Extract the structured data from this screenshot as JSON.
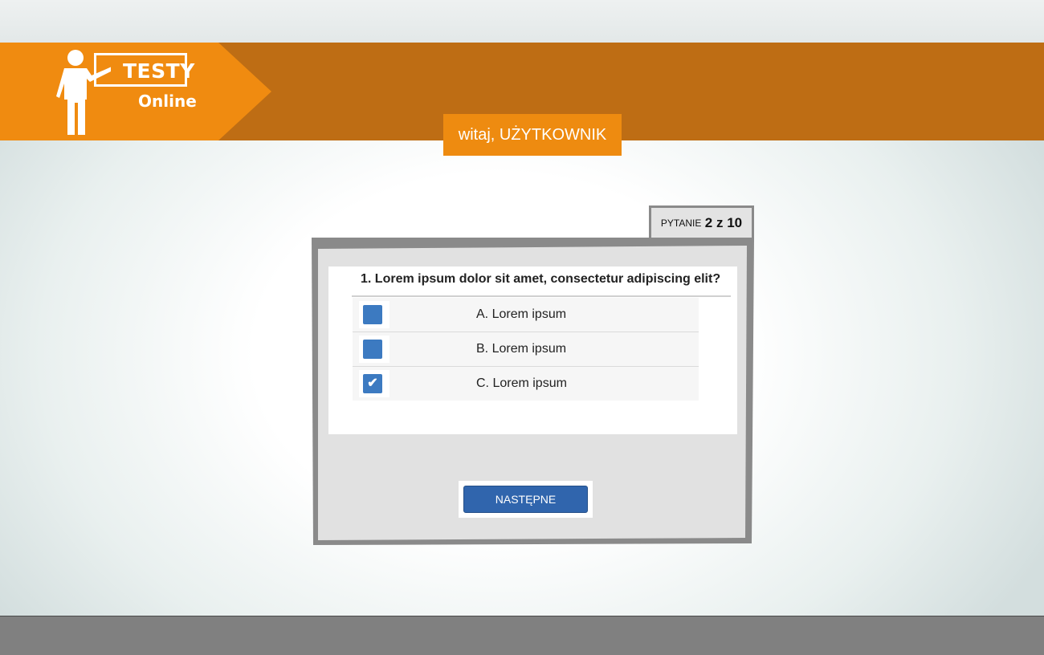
{
  "app": {
    "logo_title": "TESTY",
    "logo_subtitle": "Online"
  },
  "header": {
    "greeting": "witaj, UŻYTKOWNIK"
  },
  "counter": {
    "prefix": "PYTANIE",
    "current_of_total": "2 z 10",
    "current": 2,
    "total": 10
  },
  "quiz": {
    "question": "1. Lorem ipsum dolor sit amet, consectetur adipiscing elit?",
    "options": [
      {
        "label": "A. Lorem ipsum",
        "checked": false
      },
      {
        "label": "B. Lorem ipsum",
        "checked": false
      },
      {
        "label": "C. Lorem ipsum",
        "checked": true
      }
    ],
    "next_button": "NASTĘPNE"
  },
  "colors": {
    "header_dark_orange": "#be6d14",
    "logo_orange": "#f08b10",
    "greeting_orange": "#ee8b10",
    "checkbox_blue": "#3c7ac1",
    "button_blue": "#3065ad",
    "footer_gray": "#808080"
  }
}
